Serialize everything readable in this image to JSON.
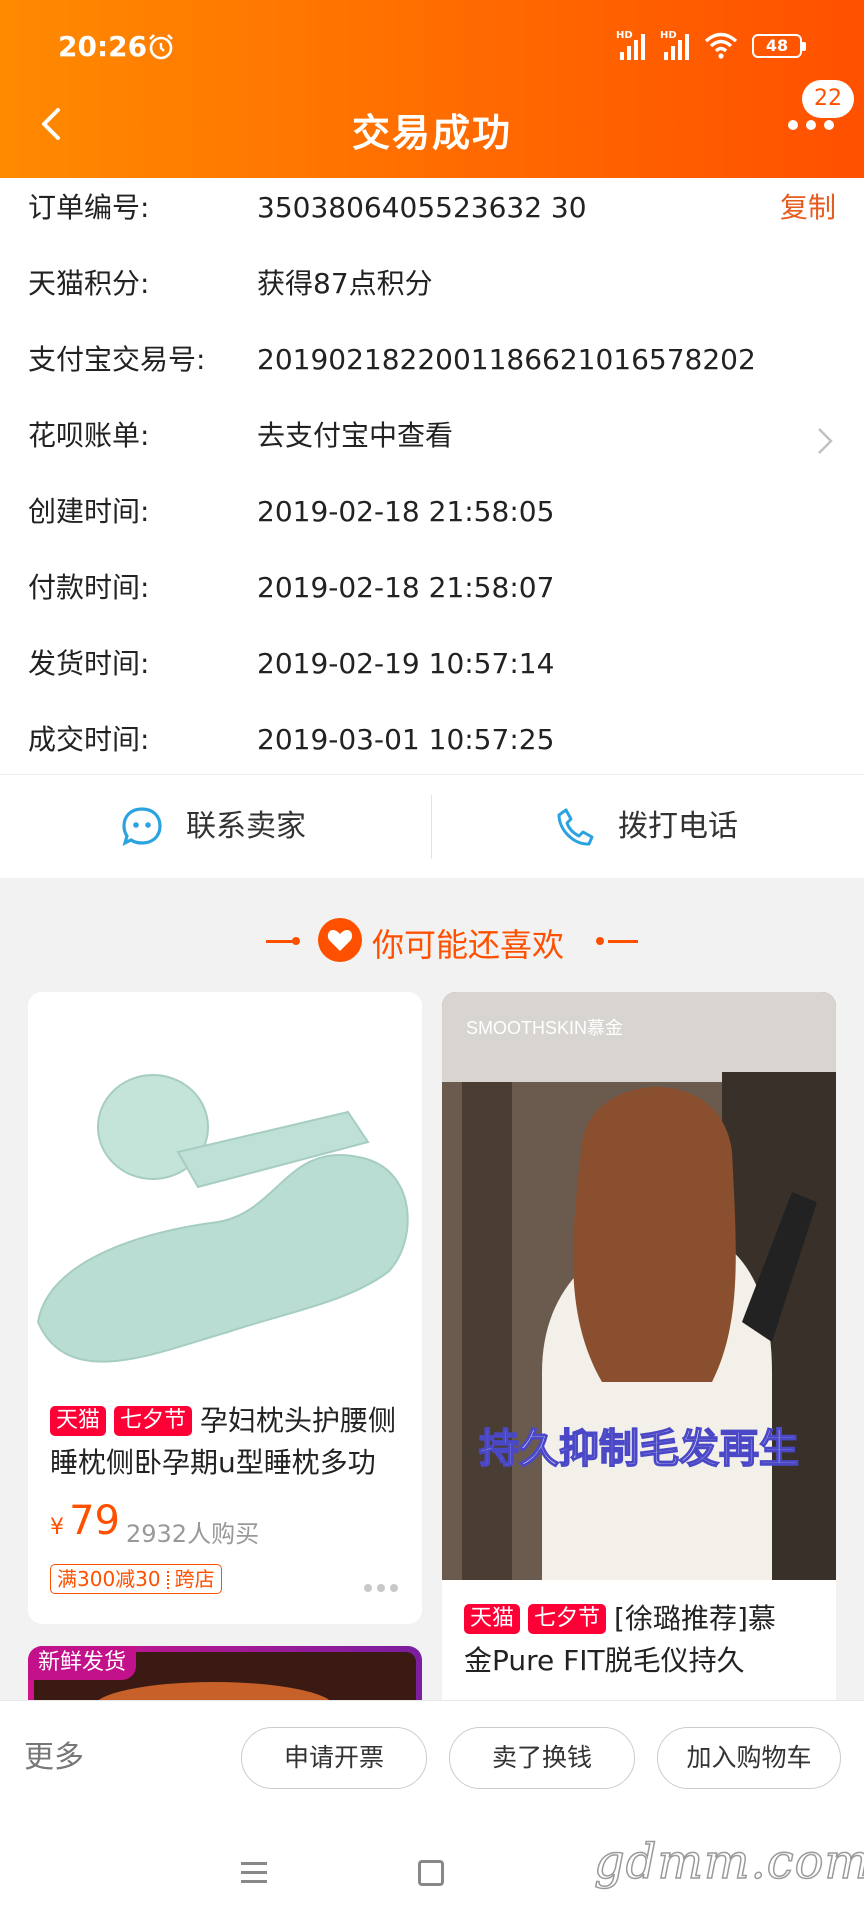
{
  "status_bar": {
    "time": "20:26",
    "network_label": "HD",
    "battery": "48"
  },
  "header": {
    "title": "交易成功",
    "message_count": "22"
  },
  "order_info": [
    {
      "label": "订单编号:",
      "value": "3503806405523632 30",
      "action": "复制"
    },
    {
      "label": "天猫积分:",
      "value": "获得87点积分"
    },
    {
      "label": "支付宝交易号:",
      "value": "2019021822001186621016578202"
    },
    {
      "label": "花呗账单:",
      "value": "去支付宝中查看"
    },
    {
      "label": "创建时间:",
      "value": "2019-02-18 21:58:05"
    },
    {
      "label": "付款时间:",
      "value": "2019-02-18 21:58:07"
    },
    {
      "label": "发货时间:",
      "value": "2019-02-19 10:57:14"
    },
    {
      "label": "成交时间:",
      "value": "2019-03-01 10:57:25"
    }
  ],
  "contact": {
    "seller_label": "联系卖家",
    "phone_label": "拨打电话"
  },
  "recommend": {
    "title": "你可能还喜欢",
    "cards": [
      {
        "tags": [
          "天猫",
          "七夕节"
        ],
        "title_line1": "孕妇枕头护腰侧",
        "title_line2": "睡枕侧卧孕期u型睡枕多功",
        "currency": "¥",
        "price": "79",
        "sold": "2932人购买",
        "promo": "满300减30",
        "promo_extra": "跨店"
      },
      {
        "brand": "SMOOTHSKIN慕金",
        "overlay": "持久抑制毛发再生",
        "tags": [
          "天猫",
          "七夕节"
        ],
        "title_line1": "[徐璐推荐]慕",
        "title_line2": "金Pure FIT脱毛仪持久"
      },
      {
        "badge": "新鲜发货"
      }
    ]
  },
  "bottom_actions": {
    "more": "更多",
    "invoice": "申请开票",
    "sell": "卖了换钱",
    "add_cart": "加入购物车"
  },
  "watermark": "gdmm.com",
  "colors": {
    "accent": "#ff5000",
    "header_start": "#ff8a00",
    "tmall_red": "#ff0036"
  }
}
